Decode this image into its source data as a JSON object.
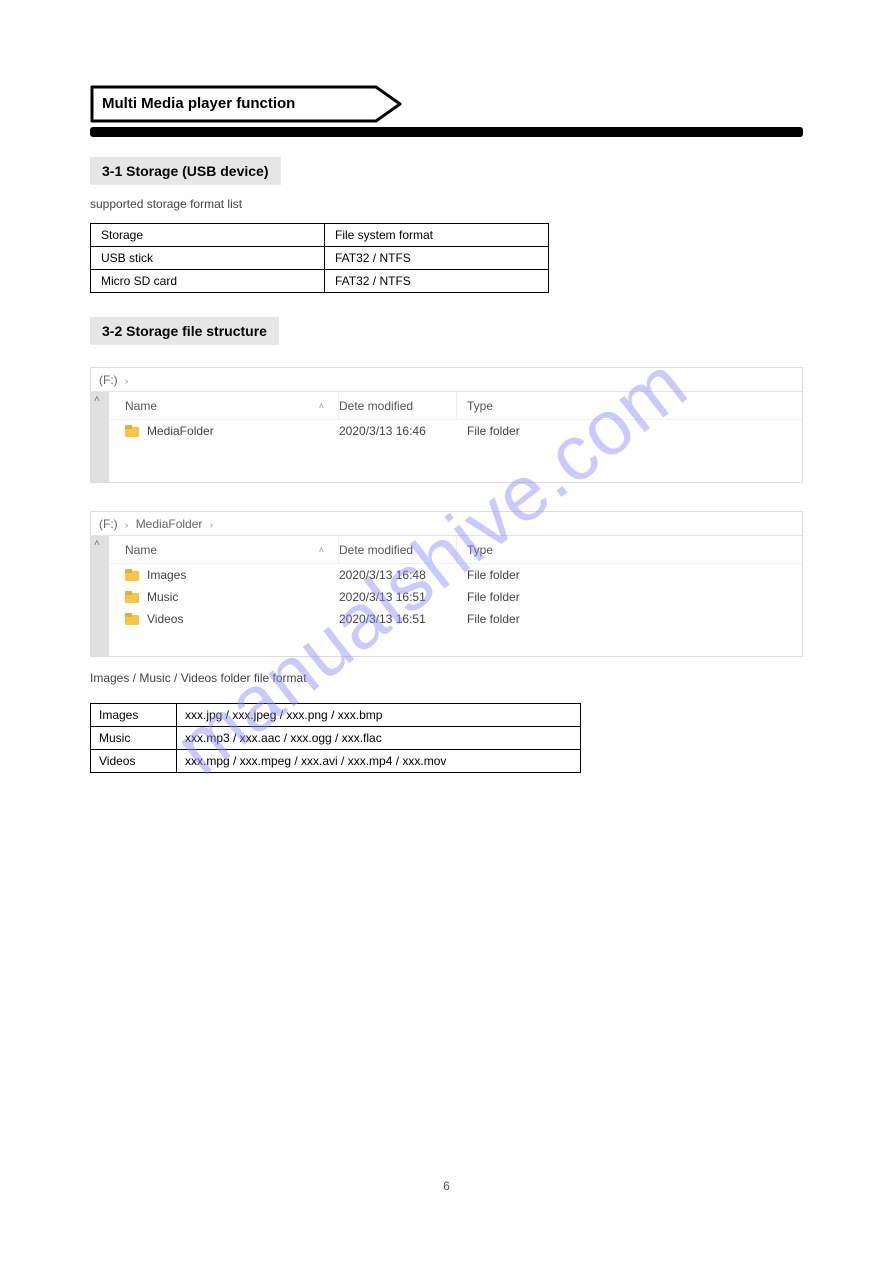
{
  "header": {
    "banner_label": "Multi Media player function",
    "section1_title": "3-1 Storage (USB device)",
    "section1_sub": "supported storage format list",
    "section2_title": "3-2 Storage file structure",
    "fmt_text": "Images / Music / Videos folder file format"
  },
  "prop_table": {
    "r1c1": "Storage",
    "r1c2": "File system format",
    "r2c1": "USB stick",
    "r2c2": "FAT32 / NTFS",
    "r3c1": "Micro SD card",
    "r3c2": "FAT32 / NTFS"
  },
  "explorer1": {
    "bc_root": "(F:)",
    "hdr_name": "Name",
    "hdr_date": "Dete modified",
    "hdr_type": "Type",
    "rows": [
      {
        "name": "MediaFolder",
        "date": "2020/3/13 16:46",
        "type": "File folder"
      }
    ]
  },
  "explorer2": {
    "bc_root": "(F:)",
    "bc_sub": "MediaFolder",
    "hdr_name": "Name",
    "hdr_date": "Dete modified",
    "hdr_type": "Type",
    "rows": [
      {
        "name": "Images",
        "date": "2020/3/13 16:48",
        "type": "File folder"
      },
      {
        "name": "Music",
        "date": "2020/3/13 16:51",
        "type": "File folder"
      },
      {
        "name": "Videos",
        "date": "2020/3/13 16:51",
        "type": "File folder"
      }
    ]
  },
  "folders_table": {
    "r1c1": "Images",
    "r1c2": "xxx.jpg / xxx.jpeg / xxx.png / xxx.bmp",
    "r2c1": "Music",
    "r2c2": "xxx.mp3 / xxx.aac / xxx.ogg / xxx.flac",
    "r3c1": "Videos",
    "r3c2": "xxx.mpg / xxx.mpeg / xxx.avi / xxx.mp4 / xxx.mov"
  },
  "watermark": "manualshive.com",
  "page_number": "6"
}
